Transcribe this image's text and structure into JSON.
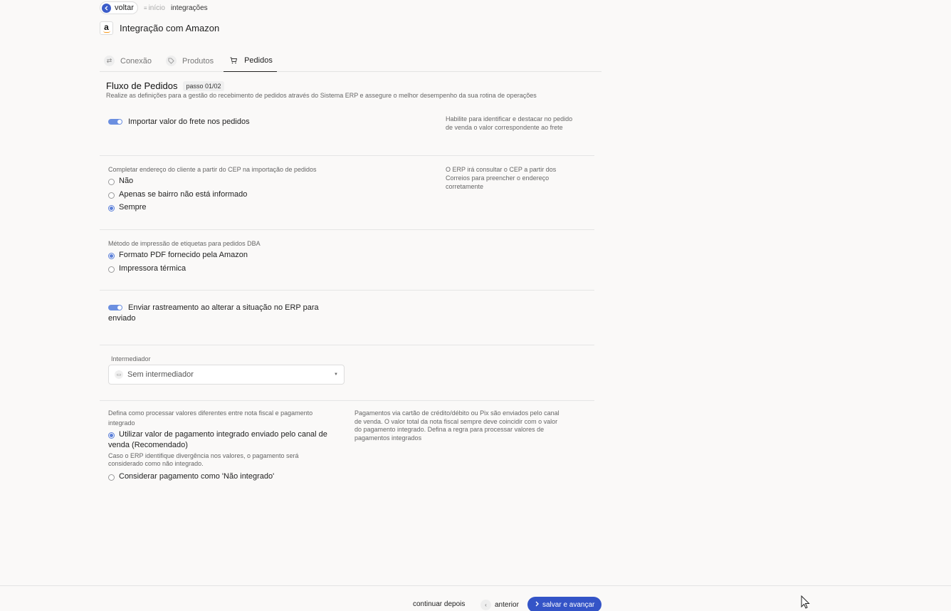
{
  "nav": {
    "back_label": "voltar",
    "breadcrumb_home": "início",
    "breadcrumb_current": "integrações"
  },
  "header": {
    "logo_letter": "a",
    "title": "Integração com Amazon"
  },
  "tabs": [
    {
      "label": "Conexão",
      "icon": "arrows-exchange-icon",
      "active": false
    },
    {
      "label": "Produtos",
      "icon": "tag-icon",
      "active": false
    },
    {
      "label": "Pedidos",
      "icon": "cart-icon",
      "active": true
    }
  ],
  "flow": {
    "title": "Fluxo de Pedidos",
    "step": "passo 01/02",
    "description": "Realize as definições para a gestão do recebimento de pedidos através do Sistema ERP e assegure o melhor desempenho da sua rotina de operações"
  },
  "freight": {
    "label": "Importar valor do frete nos pedidos",
    "enabled": true,
    "help": "Habilite para identificar e destacar no pedido de venda o valor correspondente ao frete"
  },
  "address": {
    "label": "Completar endereço do cliente a partir do CEP na importação de pedidos",
    "options": [
      "Não",
      "Apenas se bairro não está informado",
      "Sempre"
    ],
    "selected": 2,
    "help": "O ERP irá consultar o CEP a partir dos Correios para preencher o endereço corretamente"
  },
  "labels": {
    "label": "Método de impressão de etiquetas para pedidos DBA",
    "options": [
      "Formato PDF fornecido pela Amazon",
      "Impressora térmica"
    ],
    "selected": 0
  },
  "tracking": {
    "label_line1": "Enviar rastreamento ao alterar a situação no ERP para",
    "label_line2": "enviado",
    "enabled": true
  },
  "intermediary": {
    "label": "Intermediador",
    "value": "Sem intermediador"
  },
  "payment": {
    "label_line1": "Defina como processar valores diferentes entre nota fiscal e pagamento",
    "label_line2": "integrado",
    "option1_line1": "Utilizar valor de pagamento integrado enviado pelo canal de",
    "option1_line2": "venda (Recomendado)",
    "option1_note_line1": "Caso o ERP identifique divergência nos valores, o pagamento será",
    "option1_note_line2": "considerado como não integrado.",
    "option2": "Considerar pagamento como 'Não integrado'",
    "selected": 0,
    "help_line1": "Pagamentos via cartão de crédito/débito ou Pix são enviados pelo canal",
    "help_line2": "de venda. O valor total da nota fiscal sempre deve coincidir com o valor",
    "help_line3": "do pagamento integrado. Defina a regra para processar valores de",
    "help_line4": "pagamentos integrados"
  },
  "footer": {
    "later": "continuar depois",
    "previous": "anterior",
    "save": "salvar e avançar"
  },
  "colors": {
    "accent": "#3454c7",
    "toggle": "#6b8fe0",
    "amazon_orange": "#f79a1d"
  }
}
